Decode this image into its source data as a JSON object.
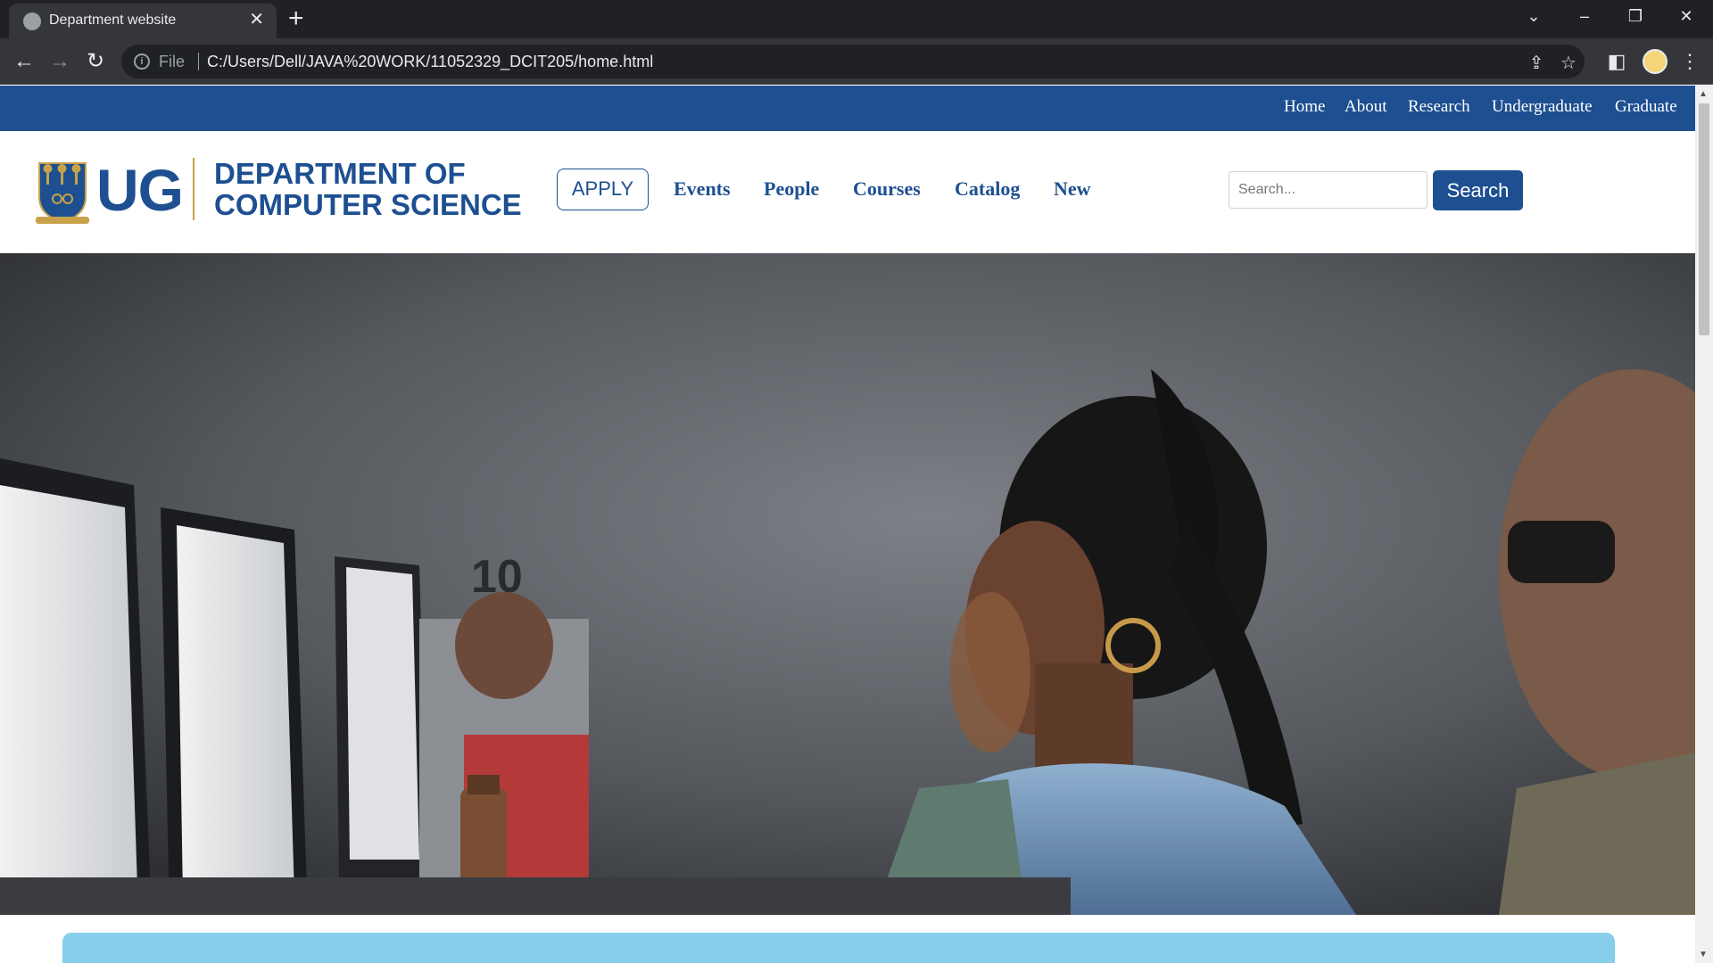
{
  "browser": {
    "tab_title": "Department website",
    "address_scheme_label": "File",
    "url": "C:/Users/Dell/JAVA%20WORK/11052329_DCIT205/home.html"
  },
  "topnav": {
    "items": [
      {
        "label": "Home"
      },
      {
        "label": "About"
      },
      {
        "label": "Research"
      },
      {
        "label": "Undergraduate"
      },
      {
        "label": "Graduate"
      }
    ]
  },
  "header": {
    "logo_ug": "UG",
    "dept_line1": "DEPARTMENT OF",
    "dept_line2": "COMPUTER SCIENCE",
    "apply_label": "APPLY",
    "nav": [
      {
        "label": "Events"
      },
      {
        "label": "People"
      },
      {
        "label": "Courses"
      },
      {
        "label": "Catalog"
      },
      {
        "label": "New"
      }
    ],
    "search_placeholder": "Search...",
    "search_button": "Search"
  },
  "hero": {
    "monitor_number": "10"
  },
  "colors": {
    "brand_blue": "#1d4f91",
    "gold": "#c8a24a",
    "info_strip": "#87ceeb"
  }
}
